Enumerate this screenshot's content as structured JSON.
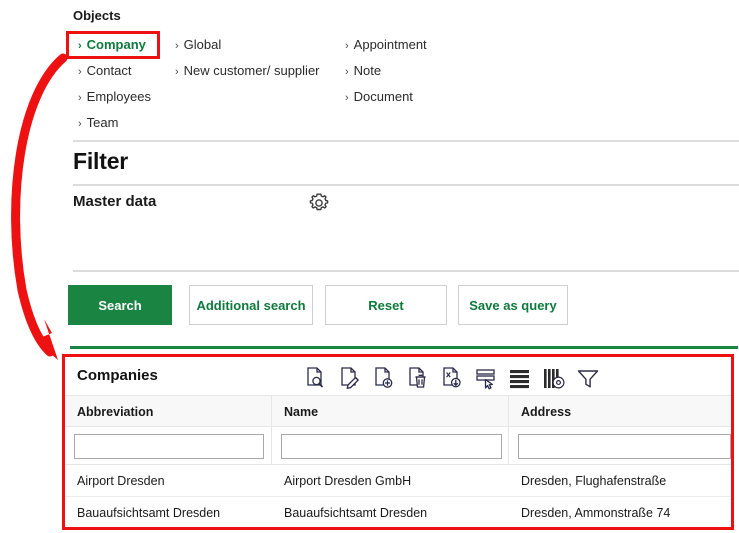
{
  "nav": {
    "heading": "Objects",
    "columns": [
      {
        "items": [
          {
            "label": "Company",
            "active": true
          },
          {
            "label": "Contact",
            "active": false
          },
          {
            "label": "Employees",
            "active": false
          },
          {
            "label": "Team",
            "active": false
          }
        ]
      },
      {
        "items": [
          {
            "label": "Global",
            "active": false
          },
          {
            "label": "New customer/ supplier",
            "active": false
          }
        ]
      },
      {
        "items": [
          {
            "label": "Appointment",
            "active": false
          },
          {
            "label": "Note",
            "active": false
          },
          {
            "label": "Document",
            "active": false
          }
        ]
      }
    ],
    "chevron": "›"
  },
  "filter": {
    "title": "Filter",
    "section_label": "Master data",
    "settings_icon": "gear-icon"
  },
  "buttons": {
    "search": "Search",
    "additional_search": "Additional search",
    "reset": "Reset",
    "save_as_query": "Save as query"
  },
  "results": {
    "title": "Companies",
    "toolbar": [
      {
        "name": "document-view-icon",
        "tooltip": "View"
      },
      {
        "name": "document-edit-icon",
        "tooltip": "Edit"
      },
      {
        "name": "document-add-icon",
        "tooltip": "Add"
      },
      {
        "name": "document-delete-icon",
        "tooltip": "Delete"
      },
      {
        "name": "document-export-icon",
        "tooltip": "Export"
      },
      {
        "name": "select-rows-icon",
        "tooltip": "Select rows"
      },
      {
        "name": "row-height-icon",
        "tooltip": "Row layout"
      },
      {
        "name": "column-settings-icon",
        "tooltip": "Column settings"
      },
      {
        "name": "filter-funnel-icon",
        "tooltip": "Filter"
      }
    ],
    "columns": [
      "Abbreviation",
      "Name",
      "Address"
    ],
    "column_filters": [
      "",
      "",
      ""
    ],
    "filter_placeholder": "",
    "rows": [
      {
        "abbreviation": "Airport Dresden",
        "name": "Airport Dresden GmbH",
        "address": "Dresden, Flughafenstraße"
      },
      {
        "abbreviation": "Bauaufsichtsamt Dresden",
        "name": "Bauaufsichtsamt Dresden",
        "address": "Dresden, Ammonstraße 74"
      }
    ]
  },
  "annotation": {
    "arrow": "curved-red-arrow",
    "highlights": [
      "company-nav-item",
      "companies-results-panel"
    ]
  },
  "colors": {
    "brand_green": "#1a8443",
    "link_green": "#0f7a3d",
    "annotation_red": "#ee1111",
    "divider_gray": "#dcdcdc",
    "header_bg": "#f8f8f8"
  }
}
